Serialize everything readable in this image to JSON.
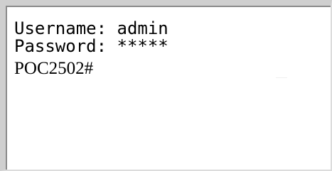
{
  "terminal": {
    "lines": [
      {
        "label": "Username:",
        "value": "admin"
      },
      {
        "label": "Password:",
        "value": "*****"
      }
    ],
    "prompt": "POC2502#"
  }
}
